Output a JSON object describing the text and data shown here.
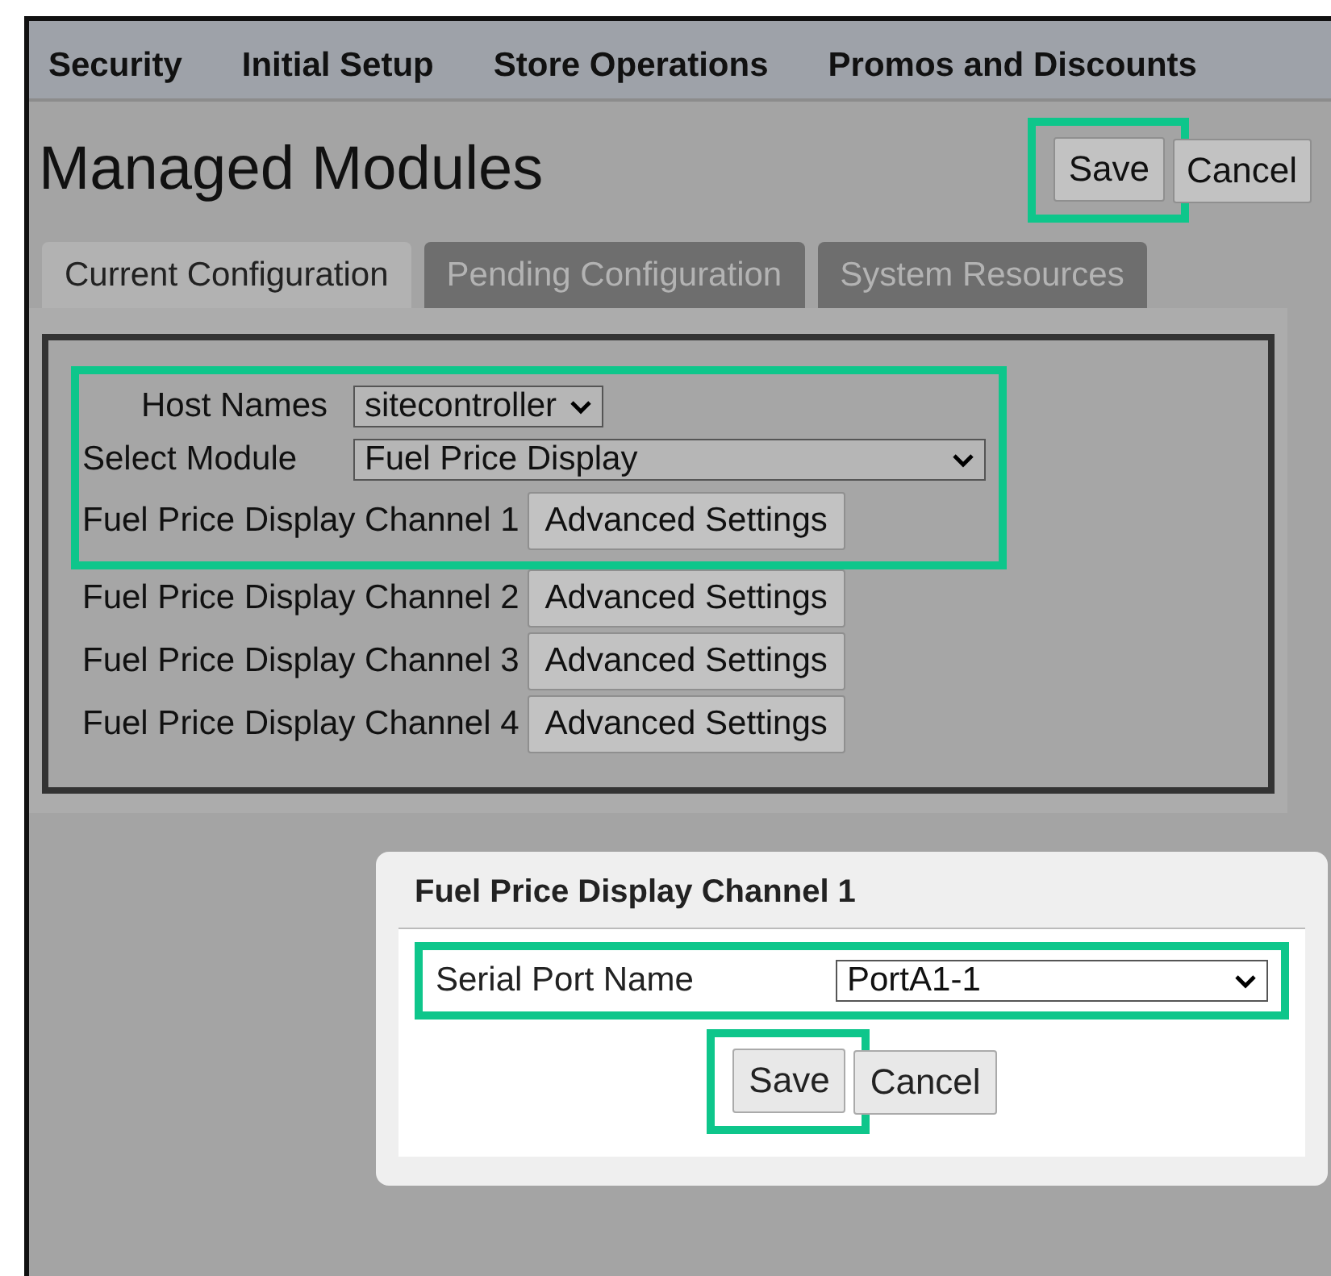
{
  "menu_bar": [
    {
      "label": "Security"
    },
    {
      "label": "Initial Setup"
    },
    {
      "label": "Store Operations"
    },
    {
      "label": "Promos and Discounts"
    }
  ],
  "page_title": "Managed Modules",
  "header_buttons": [
    {
      "label": "Save",
      "highlighted": true
    },
    {
      "label": "Cancel",
      "highlighted": false
    }
  ],
  "tabs": [
    {
      "label": "Current Configuration",
      "selected": true
    },
    {
      "label": "Pending Configuration",
      "selected": false
    },
    {
      "label": "System Resources",
      "selected": false
    }
  ],
  "form_rows": [
    {
      "kind": "select",
      "label": "Host Names",
      "value": "sitecontroller",
      "wide": false,
      "highlighted": true
    },
    {
      "kind": "select",
      "label": "Select Module",
      "value": "Fuel Price Display",
      "wide": true,
      "highlighted": true
    },
    {
      "kind": "channel",
      "label": "Fuel Price Display Channel 1",
      "button": "Advanced Settings",
      "highlighted": true
    },
    {
      "kind": "channel",
      "label": "Fuel Price Display Channel 2",
      "button": "Advanced Settings",
      "highlighted": false
    },
    {
      "kind": "channel",
      "label": "Fuel Price Display Channel 3",
      "button": "Advanced Settings",
      "highlighted": false
    },
    {
      "kind": "channel",
      "label": "Fuel Price Display Channel 4",
      "button": "Advanced Settings",
      "highlighted": false
    }
  ],
  "dialog": {
    "title": "Fuel Price Display Channel 1",
    "field": {
      "label": "Serial Port Name",
      "value": "PortA1-1",
      "highlighted": true
    },
    "buttons": [
      {
        "label": "Save",
        "highlighted": true
      },
      {
        "label": "Cancel",
        "highlighted": false
      }
    ]
  }
}
